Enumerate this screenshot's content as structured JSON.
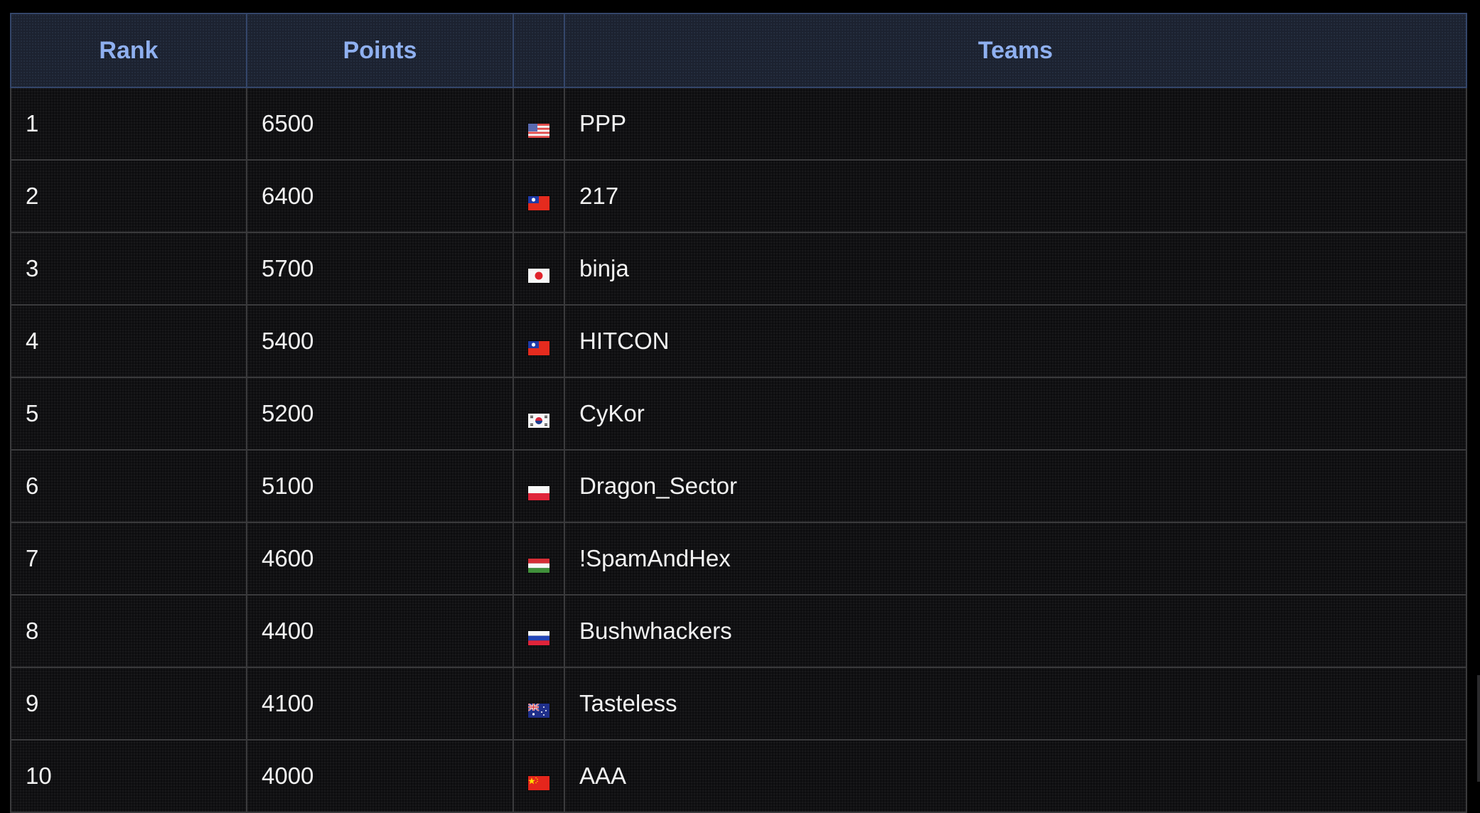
{
  "columns": {
    "rank": "Rank",
    "points": "Points",
    "flag": "",
    "teams": "Teams"
  },
  "rows": [
    {
      "rank": "1",
      "points": "6500",
      "flag": "us-flag-icon",
      "team": "PPP"
    },
    {
      "rank": "2",
      "points": "6400",
      "flag": "taiwan-flag-icon",
      "team": "217"
    },
    {
      "rank": "3",
      "points": "5700",
      "flag": "japan-flag-icon",
      "team": "binja"
    },
    {
      "rank": "4",
      "points": "5400",
      "flag": "taiwan-flag-icon",
      "team": "HITCON"
    },
    {
      "rank": "5",
      "points": "5200",
      "flag": "south-korea-flag-icon",
      "team": "CyKor"
    },
    {
      "rank": "6",
      "points": "5100",
      "flag": "poland-flag-icon",
      "team": "Dragon_Sector"
    },
    {
      "rank": "7",
      "points": "4600",
      "flag": "hungary-flag-icon",
      "team": "!SpamAndHex"
    },
    {
      "rank": "8",
      "points": "4400",
      "flag": "russia-flag-icon",
      "team": "Bushwhackers"
    },
    {
      "rank": "9",
      "points": "4100",
      "flag": "australia-flag-icon",
      "team": "Tasteless"
    },
    {
      "rank": "10",
      "points": "4000",
      "flag": "china-flag-icon",
      "team": "AAA"
    }
  ],
  "colors": {
    "header_text": "#8fb0f0",
    "row_text": "#f2f2f2",
    "background": "#000000"
  }
}
